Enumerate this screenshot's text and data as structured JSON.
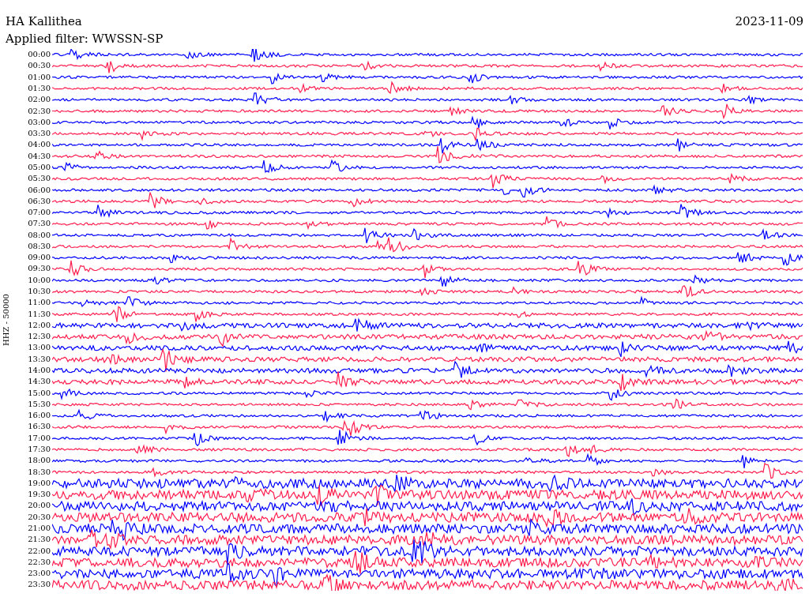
{
  "header": {
    "station": "HA Kallithea",
    "date": "2023-11-09",
    "filter": "Applied filter: WWSSN-SP"
  },
  "axis_label": "HHZ - 50000",
  "rows": [
    {
      "time": "00:00",
      "color": "#0000ff"
    },
    {
      "time": "00:30",
      "color": "#ff1f4f"
    },
    {
      "time": "01:00",
      "color": "#0000ff"
    },
    {
      "time": "01:30",
      "color": "#ff1f4f"
    },
    {
      "time": "02:00",
      "color": "#0000ff"
    },
    {
      "time": "02:30",
      "color": "#ff1f4f"
    },
    {
      "time": "03:00",
      "color": "#0000ff"
    },
    {
      "time": "03:30",
      "color": "#ff1f4f"
    },
    {
      "time": "04:00",
      "color": "#0000ff"
    },
    {
      "time": "04:30",
      "color": "#ff1f4f"
    },
    {
      "time": "05:00",
      "color": "#0000ff"
    },
    {
      "time": "05:30",
      "color": "#ff1f4f"
    },
    {
      "time": "06:00",
      "color": "#0000ff"
    },
    {
      "time": "06:30",
      "color": "#ff1f4f"
    },
    {
      "time": "07:00",
      "color": "#0000ff"
    },
    {
      "time": "07:30",
      "color": "#ff1f4f"
    },
    {
      "time": "08:00",
      "color": "#0000ff"
    },
    {
      "time": "08:30",
      "color": "#ff1f4f"
    },
    {
      "time": "09:00",
      "color": "#0000ff"
    },
    {
      "time": "09:30",
      "color": "#ff1f4f"
    },
    {
      "time": "10:00",
      "color": "#0000ff"
    },
    {
      "time": "10:30",
      "color": "#ff1f4f"
    },
    {
      "time": "11:00",
      "color": "#0000ff"
    },
    {
      "time": "11:30",
      "color": "#ff1f4f"
    },
    {
      "time": "12:00",
      "color": "#0000ff"
    },
    {
      "time": "12:30",
      "color": "#ff1f4f"
    },
    {
      "time": "13:00",
      "color": "#0000ff"
    },
    {
      "time": "13:30",
      "color": "#ff1f4f"
    },
    {
      "time": "14:00",
      "color": "#0000ff"
    },
    {
      "time": "14:30",
      "color": "#ff1f4f"
    },
    {
      "time": "15:00",
      "color": "#0000ff"
    },
    {
      "time": "15:30",
      "color": "#ff1f4f"
    },
    {
      "time": "16:00",
      "color": "#0000ff"
    },
    {
      "time": "16:30",
      "color": "#ff1f4f"
    },
    {
      "time": "17:00",
      "color": "#0000ff"
    },
    {
      "time": "17:30",
      "color": "#ff1f4f"
    },
    {
      "time": "18:00",
      "color": "#0000ff"
    },
    {
      "time": "18:30",
      "color": "#ff1f4f"
    },
    {
      "time": "19:00",
      "color": "#0000ff"
    },
    {
      "time": "19:30",
      "color": "#ff1f4f"
    },
    {
      "time": "20:00",
      "color": "#0000ff"
    },
    {
      "time": "20:30",
      "color": "#ff1f4f"
    },
    {
      "time": "21:00",
      "color": "#0000ff"
    },
    {
      "time": "21:30",
      "color": "#ff1f4f"
    },
    {
      "time": "22:00",
      "color": "#0000ff"
    },
    {
      "time": "22:30",
      "color": "#ff1f4f"
    },
    {
      "time": "23:00",
      "color": "#0000ff"
    },
    {
      "time": "23:30",
      "color": "#ff1f4f"
    }
  ]
}
